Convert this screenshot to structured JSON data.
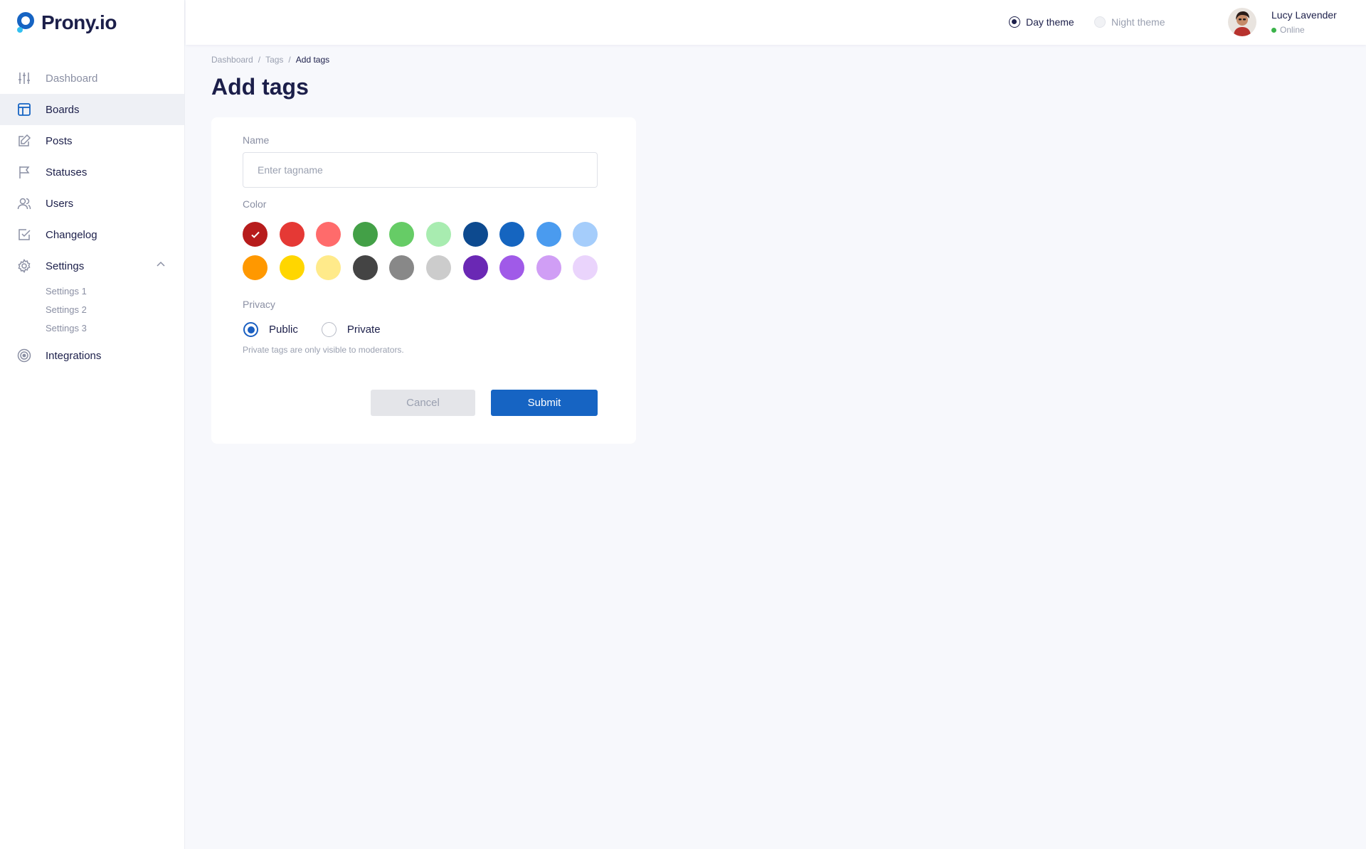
{
  "brand": {
    "name": "Prony.io"
  },
  "sidebar": {
    "items": [
      {
        "label": "Dashboard",
        "icon": "sliders-icon"
      },
      {
        "label": "Boards",
        "icon": "board-icon"
      },
      {
        "label": "Posts",
        "icon": "edit-icon"
      },
      {
        "label": "Statuses",
        "icon": "flag-icon"
      },
      {
        "label": "Users",
        "icon": "users-icon"
      },
      {
        "label": "Changelog",
        "icon": "check-square-icon"
      },
      {
        "label": "Settings",
        "icon": "gear-icon"
      },
      {
        "label": "Integrations",
        "icon": "target-icon"
      }
    ],
    "active_item": "Boards",
    "settings_subitems": [
      "Settings 1",
      "Settings 2",
      "Settings 3"
    ]
  },
  "header": {
    "themes": [
      {
        "label": "Day theme",
        "selected": true
      },
      {
        "label": "Night theme",
        "selected": false
      }
    ],
    "user": {
      "name": "Lucy Lavender",
      "status": "Online"
    }
  },
  "breadcrumb": [
    "Dashboard",
    "Tags",
    "Add tags"
  ],
  "page": {
    "title": "Add tags"
  },
  "form": {
    "name_label": "Name",
    "name_placeholder": "Enter tagname",
    "name_value": "",
    "color_label": "Color",
    "colors": [
      "#b71c1c",
      "#e53935",
      "#ff6b6b",
      "#43a047",
      "#66cc66",
      "#a8ecb0",
      "#0d4a8f",
      "#1565c0",
      "#4a9bef",
      "#a5cdfb",
      "#ff9800",
      "#ffd600",
      "#ffea8a",
      "#444444",
      "#888888",
      "#cccccc",
      "#6a28b4",
      "#a05ae8",
      "#d09ef5",
      "#ead4fc"
    ],
    "selected_color": "#b71c1c",
    "privacy_label": "Privacy",
    "privacy_options": [
      {
        "label": "Public",
        "selected": true
      },
      {
        "label": "Private",
        "selected": false
      }
    ],
    "privacy_hint": "Private tags are only visible to moderators.",
    "cancel_label": "Cancel",
    "submit_label": "Submit"
  },
  "colors": {
    "accent": "#1664c3",
    "text": "#1c1f4a",
    "muted": "#9aa0b0",
    "online": "#3bb34a"
  }
}
